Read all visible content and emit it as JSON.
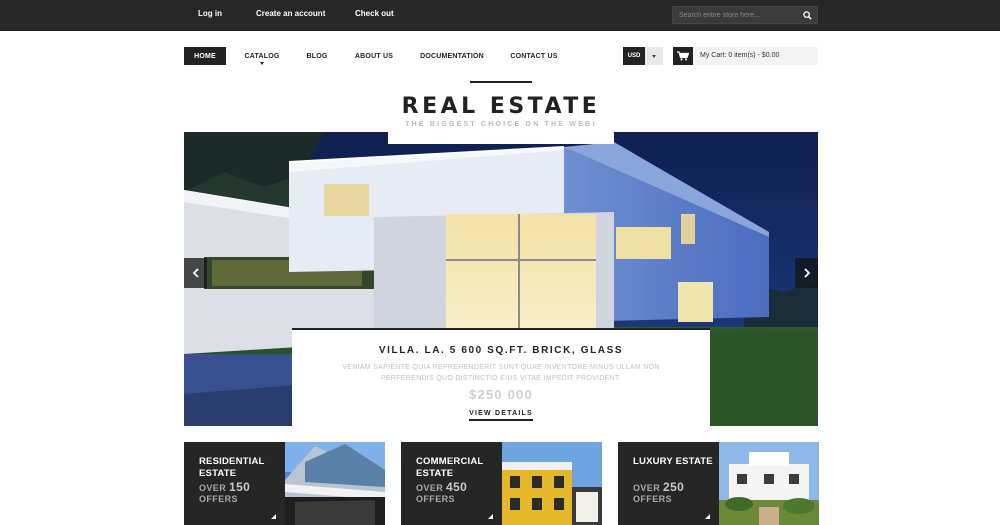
{
  "topbar": {
    "links": [
      "Log in",
      "Create an account",
      "Check out"
    ],
    "search_placeholder": "Search entire store here..."
  },
  "nav": {
    "items": [
      "HOME",
      "CATALOG",
      "BLOG",
      "ABOUT US",
      "DOCUMENTATION",
      "CONTACT US"
    ],
    "active": "HOME",
    "currency": "USD",
    "cart": "My Cart: 0 item(s) - $0.00"
  },
  "logo": {
    "title": "REAL ESTATE",
    "tagline": "THE BIGGEST CHOICE ON THE WEB!"
  },
  "slider": {
    "title": "VILLA. LA. 5 600 SQ.FT. BRICK, GLASS",
    "text": "VENIAM SAPIENTE QUIA REPREHENDERIT SUNT QUAE INVENTORE MINUS ULLAM NON PERFERENDIS QUO DISTINCTIO EIUS VITAE IMPEDIT PROVIDENT.",
    "price": "$250 000",
    "link": "VIEW DETAILS"
  },
  "categories": [
    {
      "title": "RESIDENTIAL ESTATE",
      "over": "OVER",
      "count": "150",
      "offers": "OFFERS"
    },
    {
      "title": "COMMERCIAL ESTATE",
      "over": "OVER",
      "count": "450",
      "offers": "OFFERS"
    },
    {
      "title": "LUXURY ESTATE",
      "over": "OVER",
      "count": "250",
      "offers": "OFFERS"
    }
  ],
  "colors": {
    "topbar_bg": "#272727",
    "dark": "#222222",
    "block_bg": "#262626",
    "slider_sky": "#16275a"
  },
  "icons": [
    "search-icon",
    "chevron-down-icon",
    "cart-icon",
    "chevron-left-icon",
    "chevron-right-icon"
  ]
}
